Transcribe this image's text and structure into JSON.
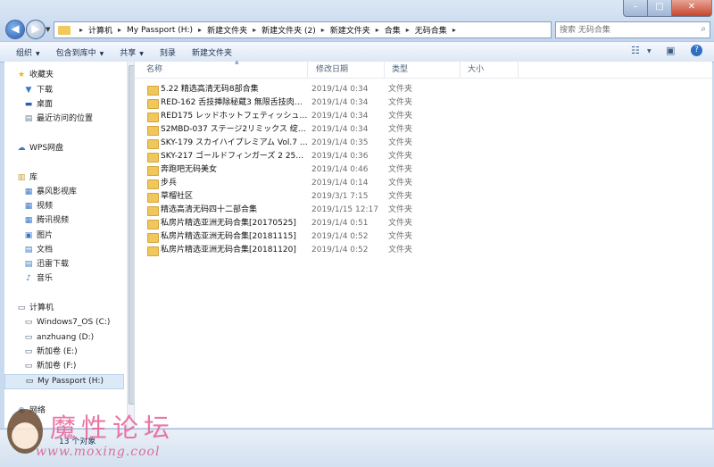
{
  "window": {
    "minimize_glyph": "–",
    "maximize_glyph": "□",
    "close_glyph": "✕"
  },
  "address": {
    "crumbs": [
      "计算机",
      "My Passport (H:)",
      "新建文件夹",
      "新建文件夹 (2)",
      "新建文件夹",
      "合集",
      "无码合集"
    ]
  },
  "search": {
    "placeholder": "搜索 无码合集"
  },
  "toolbar": {
    "organize": "组织",
    "include_in_library": "包含到库中",
    "share": "共享",
    "burn": "刻录",
    "new_folder": "新建文件夹"
  },
  "nav": {
    "favorites": "收藏夹",
    "downloads": "下载",
    "desktop": "桌面",
    "recent": "最近访问的位置",
    "wps": "WPS网盘",
    "libraries": "库",
    "storm_video": "暴风影视库",
    "video": "视频",
    "tencent_video": "腾讯视频",
    "pictures": "图片",
    "documents": "文档",
    "thunder": "迅雷下载",
    "music": "音乐",
    "computer": "计算机",
    "drive_c": "Windows7_OS (C:)",
    "drive_d": "anzhuang (D:)",
    "drive_e": "新加卷 (E:)",
    "drive_f": "新加卷 (F:)",
    "drive_h": "My Passport (H:)",
    "network": "网络"
  },
  "columns": {
    "name": "名称",
    "modified": "修改日期",
    "type": "类型",
    "size": "大小"
  },
  "files": [
    {
      "name": "5.22 精选高清无码8部合集",
      "date": "2019/1/4 0:34",
      "type": "文件夹"
    },
    {
      "name": "RED-162 舌技挿除秘蔵3 無限舌技肉棒…",
      "date": "2019/1/4 0:34",
      "type": "文件夹"
    },
    {
      "name": "RED175 レッドホットフェティッシュコ…",
      "date": "2019/1/4 0:34",
      "type": "文件夹"
    },
    {
      "name": "S2MBD-037 ステージ2リミックス 绽勢…",
      "date": "2019/1/4 0:34",
      "type": "文件夹"
    },
    {
      "name": "SKY-179 スカイハイプレミアム Vol.7 (…",
      "date": "2019/1/4 0:35",
      "type": "文件夹"
    },
    {
      "name": "SKY-217 ゴールドフィンガーズ 2 25ガ…",
      "date": "2019/1/4 0:36",
      "type": "文件夹"
    },
    {
      "name": "奔跑吧无码美女",
      "date": "2019/1/4 0:46",
      "type": "文件夹"
    },
    {
      "name": "步兵",
      "date": "2019/1/4 0:14",
      "type": "文件夹"
    },
    {
      "name": "草榴社区",
      "date": "2019/3/1 7:15",
      "type": "文件夹"
    },
    {
      "name": "精选高清无码四十二部合集",
      "date": "2019/1/15 12:17",
      "type": "文件夹"
    },
    {
      "name": "私房片精选亚洲无码合集[20170525]",
      "date": "2019/1/4 0:51",
      "type": "文件夹"
    },
    {
      "name": "私房片精选亚洲无码合集[20181115]",
      "date": "2019/1/4 0:52",
      "type": "文件夹"
    },
    {
      "name": "私房片精选亚洲无码合集[20181120]",
      "date": "2019/1/4 0:52",
      "type": "文件夹"
    }
  ],
  "status": {
    "count": "13 个对象"
  },
  "watermark": {
    "title": "魔性论坛",
    "url": "www.moxing.cool"
  }
}
